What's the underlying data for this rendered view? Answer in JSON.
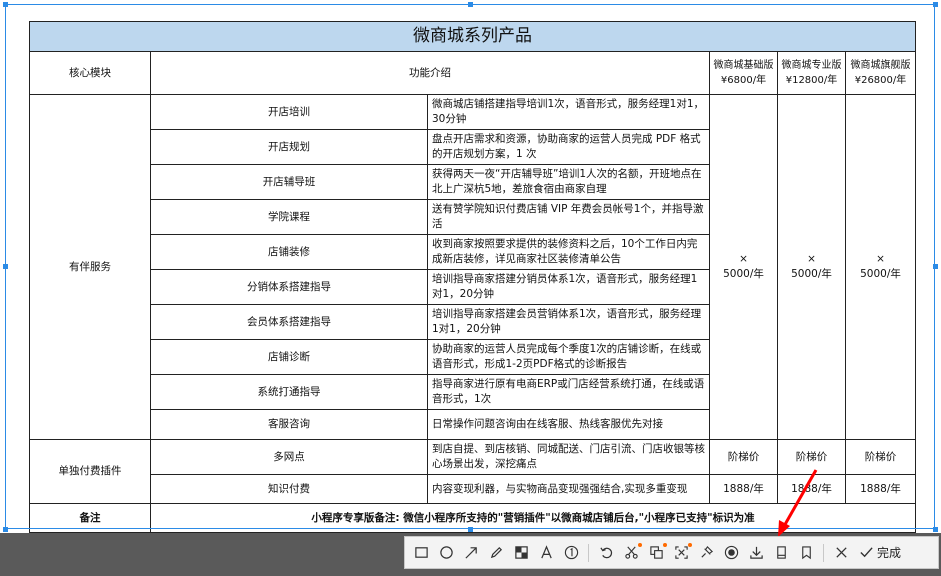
{
  "table": {
    "title": "微商城系列产品",
    "headers": {
      "module": "核心模块",
      "feature": "功能介绍",
      "plan1": "微商城基础版\n¥6800/年",
      "plan2": "微商城专业版\n¥12800/年",
      "plan3": "微商城旗舰版\n¥26800/年"
    },
    "group1": {
      "name": "有伴服务",
      "plan1": "×\n5000/年",
      "plan2": "×\n5000/年",
      "plan3": "×\n5000/年",
      "rows": [
        {
          "name": "开店培训",
          "desc": "微商城店铺搭建指导培训1次，语音形式，服务经理1对1，30分钟"
        },
        {
          "name": "开店规划",
          "desc": "盘点开店需求和资源，协助商家的运营人员完成 PDF 格式的开店规划方案，1 次"
        },
        {
          "name": "开店辅导班",
          "desc": "获得两天一夜“开店辅导班”培训1人次的名额，开班地点在北上广深杭5地，差旅食宿由商家自理"
        },
        {
          "name": "学院课程",
          "desc": "送有赞学院知识付费店铺 VIP 年费会员帐号1个，并指导激活"
        },
        {
          "name": "店铺装修",
          "desc": "收到商家按照要求提供的装修资料之后，10个工作日内完成新店装修，详见商家社区装修清单公告"
        },
        {
          "name": "分销体系搭建指导",
          "desc": "培训指导商家搭建分销员体系1次，语音形式，服务经理1对1，20分钟"
        },
        {
          "name": "会员体系搭建指导",
          "desc": "培训指导商家搭建会员营销体系1次，语音形式，服务经理1对1，20分钟"
        },
        {
          "name": "店铺诊断",
          "desc": "协助商家的运营人员完成每个季度1次的店铺诊断，在线或语音形式，形成1-2页PDF格式的诊断报告"
        },
        {
          "name": "系统打通指导",
          "desc": "指导商家进行原有电商ERP或门店经营系统打通，在线或语音形式，1次"
        },
        {
          "name": "客服咨询",
          "desc": "日常操作问题咨询由在线客服、热线客服优先对接"
        }
      ]
    },
    "group2": {
      "name": "单独付费插件",
      "rows": [
        {
          "name": "多网点",
          "desc": "到店自提、到店核销、同城配送、门店引流、门店收银等核心场景出发，深挖痛点",
          "p1": "阶梯价",
          "p2": "阶梯价",
          "p3": "阶梯价"
        },
        {
          "name": "知识付费",
          "desc": "内容变现利器，与实物商品变现强强结合,实现多重变现",
          "p1": "1888/年",
          "p2": "1888/年",
          "p3": "1888/年"
        }
      ]
    },
    "note": {
      "label": "备注",
      "text": "小程序专享版备注: 微信小程序所支持的\"营销插件\"以微商城店铺后台,\"小程序已支持\"标识为准"
    }
  },
  "toolbar": {
    "done_label": "完成",
    "accent_color": "#ff6a00",
    "selection_color": "#2b8be6",
    "annotation_arrow_color": "#ff0000",
    "tools": [
      "rectangle-icon",
      "ellipse-icon",
      "arrow-icon",
      "pen-icon",
      "mosaic-icon",
      "text-icon",
      "number-icon",
      "undo-icon",
      "ocr-icon",
      "translate-icon",
      "scan-icon",
      "pin-icon",
      "record-icon",
      "download-icon",
      "long-screenshot-icon",
      "bookmark-icon",
      "close-icon",
      "check-icon"
    ]
  }
}
